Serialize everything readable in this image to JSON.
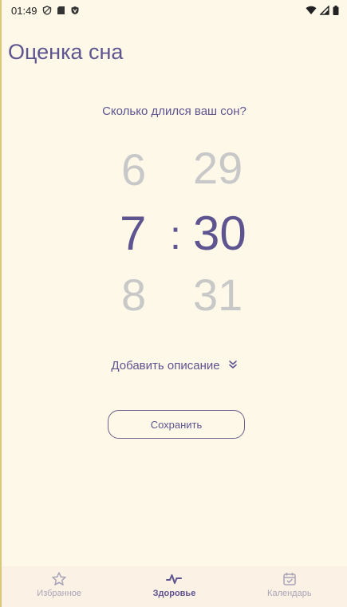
{
  "status_bar": {
    "time": "01:49"
  },
  "header": {
    "title": "Оценка сна"
  },
  "question": "Сколько длился ваш сон?",
  "picker": {
    "hours": {
      "prev": "6",
      "current": "7",
      "next": "8"
    },
    "separator": ":",
    "minutes": {
      "prev": "29",
      "current": "30",
      "next": "31"
    }
  },
  "add_description": {
    "label": "Добавить описание",
    "icon": "double-chevron-down-icon"
  },
  "save_button": {
    "label": "Сохранить"
  },
  "bottom_nav": {
    "items": [
      {
        "label": "Избранное",
        "icon": "star-icon",
        "active": false
      },
      {
        "label": "Здоровье",
        "icon": "pulse-icon",
        "active": true
      },
      {
        "label": "Календарь",
        "icon": "calendar-check-icon",
        "active": false
      }
    ]
  },
  "colors": {
    "background": "#fdf8e8",
    "accent": "#5e5490",
    "inactive": "#c8c8c8",
    "nav_background": "#fbf1e4"
  }
}
